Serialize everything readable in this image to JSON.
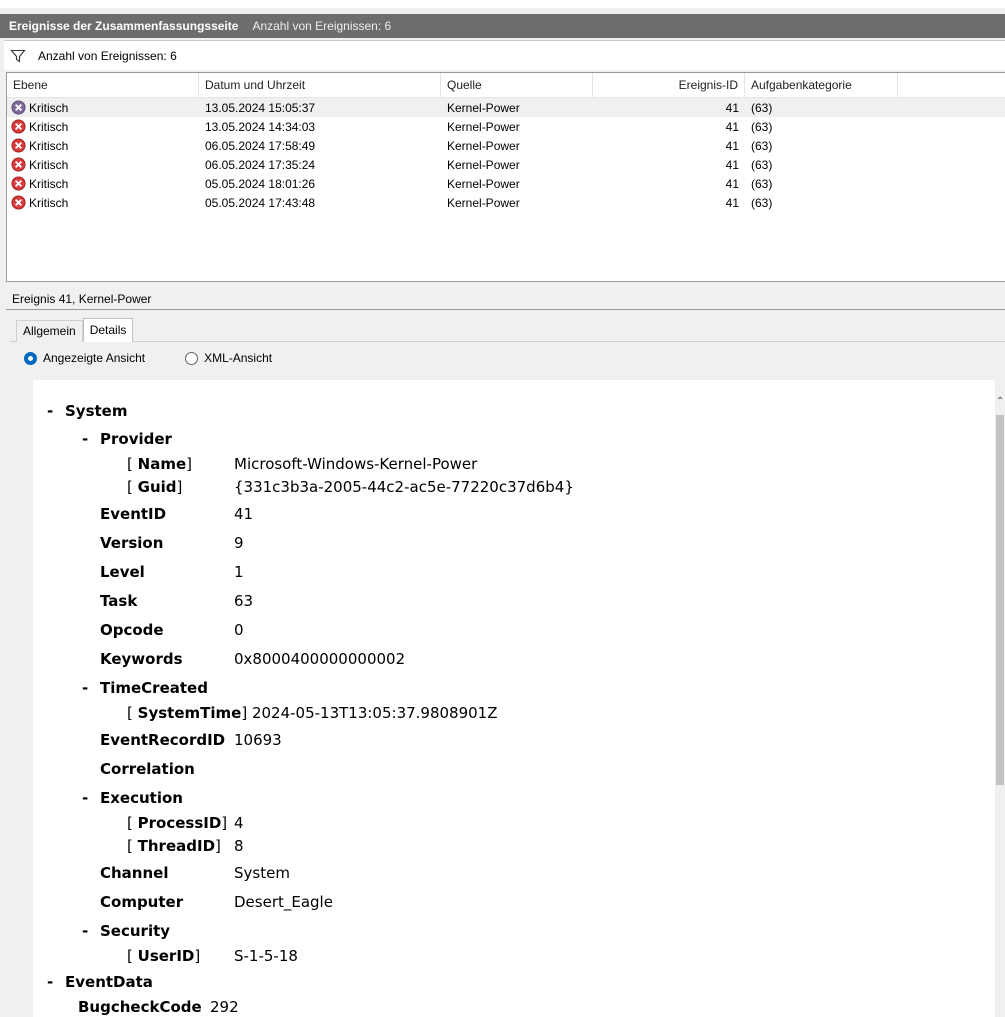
{
  "header": {
    "title": "Ereignisse der Zusammenfassungsseite",
    "count": "Anzahl von Ereignissen: 6"
  },
  "filter": {
    "text": "Anzahl von Ereignissen: 6"
  },
  "table": {
    "columns": [
      "Ebene",
      "Datum und Uhrzeit",
      "Quelle",
      "Ereignis-ID",
      "Aufgabenkategorie"
    ],
    "rows": [
      [
        "Kritisch",
        "13.05.2024 15:05:37",
        "Kernel-Power",
        "41",
        "(63)"
      ],
      [
        "Kritisch",
        "13.05.2024 14:34:03",
        "Kernel-Power",
        "41",
        "(63)"
      ],
      [
        "Kritisch",
        "06.05.2024 17:58:49",
        "Kernel-Power",
        "41",
        "(63)"
      ],
      [
        "Kritisch",
        "06.05.2024 17:35:24",
        "Kernel-Power",
        "41",
        "(63)"
      ],
      [
        "Kritisch",
        "05.05.2024 18:01:26",
        "Kernel-Power",
        "41",
        "(63)"
      ],
      [
        "Kritisch",
        "05.05.2024 17:43:48",
        "Kernel-Power",
        "41",
        "(63)"
      ]
    ]
  },
  "detail": {
    "title": "Ereignis 41, Kernel-Power",
    "tabs": [
      "Allgemein",
      "Details"
    ],
    "radio_friendly": "Angezeigte Ansicht",
    "radio_xml": "XML-Ansicht"
  },
  "tree": {
    "minus": "-",
    "lb": "[",
    "rb": "]",
    "system": "System",
    "provider": "Provider",
    "name_key": "Name",
    "name_val": "Microsoft-Windows-Kernel-Power",
    "guid_key": "Guid",
    "guid_val": "{331c3b3a-2005-44c2-ac5e-77220c37d6b4}",
    "eventid_key": "EventID",
    "eventid_val": "41",
    "version_key": "Version",
    "version_val": "9",
    "level_key": "Level",
    "level_val": "1",
    "task_key": "Task",
    "task_val": "63",
    "opcode_key": "Opcode",
    "opcode_val": "0",
    "keywords_key": "Keywords",
    "keywords_val": "0x8000400000000002",
    "timecreated": "TimeCreated",
    "systemtime_key": "SystemTime",
    "systemtime_val": "2024-05-13T13:05:37.9808901Z",
    "recordid_key": "EventRecordID",
    "recordid_val": "10693",
    "correlation": "Correlation",
    "execution": "Execution",
    "processid_key": "ProcessID",
    "processid_val": "4",
    "threadid_key": "ThreadID",
    "threadid_val": "8",
    "channel_key": "Channel",
    "channel_val": "System",
    "computer_key": "Computer",
    "computer_val": "Desert_Eagle",
    "security": "Security",
    "userid_key": "UserID",
    "userid_val": "S-1-5-18",
    "eventdata": "EventData",
    "bugcheck_key": "BugcheckCode",
    "bugcheck_val": "292"
  }
}
